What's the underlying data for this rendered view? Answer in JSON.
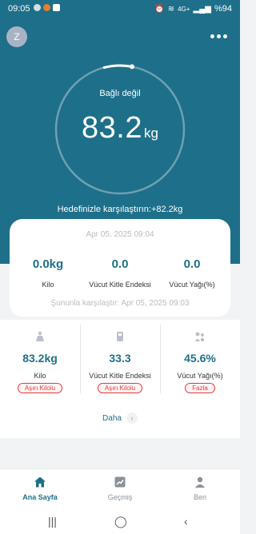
{
  "status_bar": {
    "time": "09:05",
    "battery": "%94",
    "network": "4G+"
  },
  "header": {
    "avatar_letter": "Z"
  },
  "gauge": {
    "status": "Bağlı değil",
    "value": "83.2",
    "unit": "kg",
    "progress_fraction": 0.03,
    "target_text": "Hedefinizle karşılaştırın:+82.2kg"
  },
  "comparison": {
    "date": "Apr 05, 2025 09:04",
    "items": [
      {
        "value": "0.0kg",
        "label": "Kilo"
      },
      {
        "value": "0.0",
        "label": "Vücut Kitle Endeksi"
      },
      {
        "value": "0.0",
        "label": "Vücut Yağı(%)"
      }
    ],
    "compared_with": "Şununla karşılaştır: Apr 05, 2025 09:03"
  },
  "metrics": {
    "items": [
      {
        "value": "83.2kg",
        "label": "Kilo",
        "badge": "Aşırı Kilolu",
        "icon": "scale-icon"
      },
      {
        "value": "33.3",
        "label": "Vücut Kitle Endeksi",
        "badge": "Aşırı Kilolu",
        "icon": "bmi-icon"
      },
      {
        "value": "45.6%",
        "label": "Vücut Yağı(%)",
        "badge": "Fazla",
        "icon": "body-fat-icon"
      }
    ],
    "more_label": "Daha"
  },
  "nav": {
    "items": [
      {
        "label": "Ana Sayfa",
        "icon": "home-icon",
        "active": true
      },
      {
        "label": "Geçmiş",
        "icon": "history-chart-icon",
        "active": false
      },
      {
        "label": "Ben",
        "icon": "profile-icon",
        "active": false
      }
    ]
  },
  "colors": {
    "primary": "#1e6f89",
    "alert": "#e23838",
    "background": "#f2f3f5"
  }
}
